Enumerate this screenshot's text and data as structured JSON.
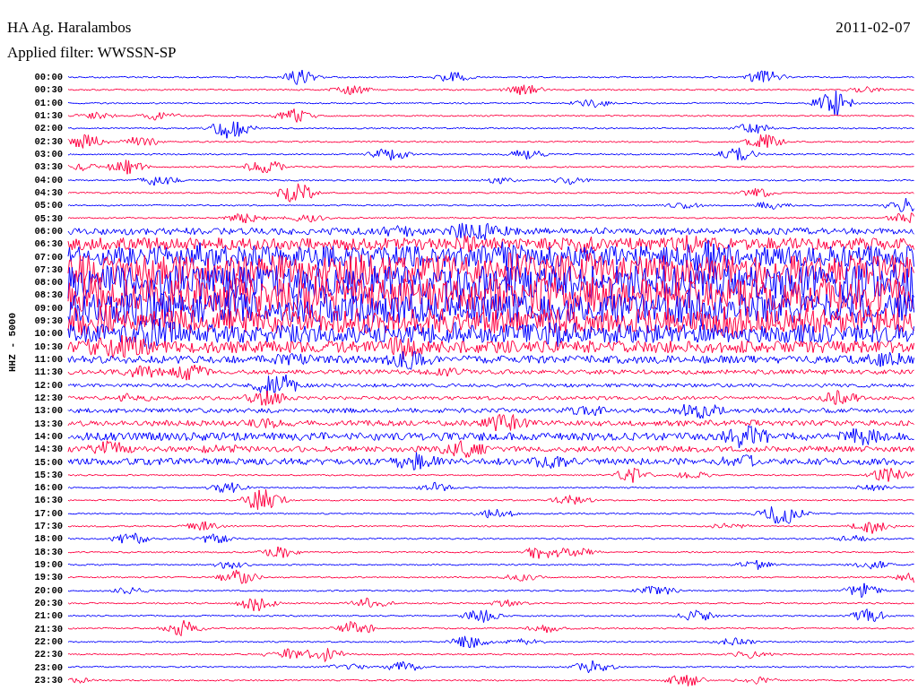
{
  "header": {
    "station": "HA Ag. Haralambos",
    "date": "2011-02-07",
    "filter": "Applied filter: WWSSN-SP"
  },
  "channel_label": "HHZ - 5000",
  "rows": [
    {
      "time": "00:00",
      "color": "#0000ff"
    },
    {
      "time": "00:30",
      "color": "#ff0040"
    },
    {
      "time": "01:00",
      "color": "#0000ff"
    },
    {
      "time": "01:30",
      "color": "#ff0040"
    },
    {
      "time": "02:00",
      "color": "#0000ff"
    },
    {
      "time": "02:30",
      "color": "#ff0040"
    },
    {
      "time": "03:00",
      "color": "#0000ff"
    },
    {
      "time": "03:30",
      "color": "#ff0040"
    },
    {
      "time": "04:00",
      "color": "#0000ff"
    },
    {
      "time": "04:30",
      "color": "#ff0040"
    },
    {
      "time": "05:00",
      "color": "#0000ff"
    },
    {
      "time": "05:30",
      "color": "#ff0040"
    },
    {
      "time": "06:00",
      "color": "#0000ff"
    },
    {
      "time": "06:30",
      "color": "#ff0040"
    },
    {
      "time": "07:00",
      "color": "#0000ff"
    },
    {
      "time": "07:30",
      "color": "#ff0040"
    },
    {
      "time": "08:00",
      "color": "#0000ff"
    },
    {
      "time": "08:30",
      "color": "#ff0040"
    },
    {
      "time": "09:00",
      "color": "#0000ff"
    },
    {
      "time": "09:30",
      "color": "#ff0040"
    },
    {
      "time": "10:00",
      "color": "#0000ff"
    },
    {
      "time": "10:30",
      "color": "#ff0040"
    },
    {
      "time": "11:00",
      "color": "#0000ff"
    },
    {
      "time": "11:30",
      "color": "#ff0040"
    },
    {
      "time": "12:00",
      "color": "#0000ff"
    },
    {
      "time": "12:30",
      "color": "#ff0040"
    },
    {
      "time": "13:00",
      "color": "#0000ff"
    },
    {
      "time": "13:30",
      "color": "#ff0040"
    },
    {
      "time": "14:00",
      "color": "#0000ff"
    },
    {
      "time": "14:30",
      "color": "#ff0040"
    },
    {
      "time": "15:00",
      "color": "#0000ff"
    },
    {
      "time": "15:30",
      "color": "#ff0040"
    },
    {
      "time": "16:00",
      "color": "#0000ff"
    },
    {
      "time": "16:30",
      "color": "#ff0040"
    },
    {
      "time": "17:00",
      "color": "#0000ff"
    },
    {
      "time": "17:30",
      "color": "#ff0040"
    },
    {
      "time": "18:00",
      "color": "#0000ff"
    },
    {
      "time": "18:30",
      "color": "#ff0040"
    },
    {
      "time": "19:00",
      "color": "#0000ff"
    },
    {
      "time": "19:30",
      "color": "#ff0040"
    },
    {
      "time": "20:00",
      "color": "#0000ff"
    },
    {
      "time": "20:30",
      "color": "#ff0040"
    },
    {
      "time": "21:00",
      "color": "#0000ff"
    },
    {
      "time": "21:30",
      "color": "#ff0040"
    },
    {
      "time": "22:00",
      "color": "#0000ff"
    },
    {
      "time": "22:30",
      "color": "#ff0040"
    },
    {
      "time": "23:00",
      "color": "#0000ff"
    },
    {
      "time": "23:30",
      "color": "#ff0040"
    }
  ]
}
